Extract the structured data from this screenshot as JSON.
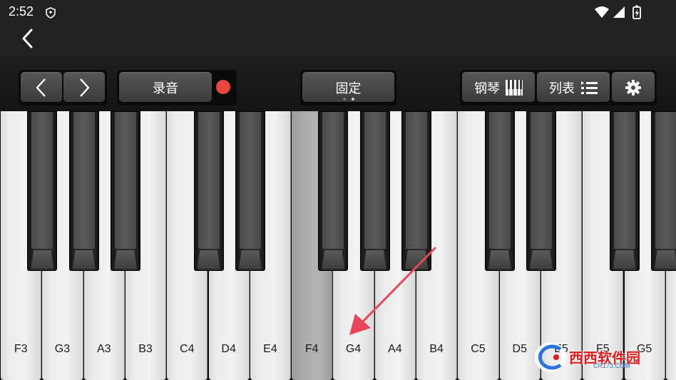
{
  "status_bar": {
    "time": "2:52",
    "icons": [
      "shield-icon",
      "wifi-icon",
      "signal-icon",
      "battery-charging-icon"
    ]
  },
  "app_bar": {
    "back_icon": "chevron-left-icon"
  },
  "toolbar": {
    "prev_icon": "chevron-left-icon",
    "next_icon": "chevron-right-icon",
    "record_label": "录音",
    "record_indicator_color": "#e8473d",
    "fixed_label": "固定",
    "fixed_pages": {
      "count": 2,
      "active": 2
    },
    "piano_label": "钢琴",
    "piano_icon": "piano-keys-icon",
    "list_label": "列表",
    "list_icon": "list-icon",
    "settings_icon": "gear-icon"
  },
  "keyboard": {
    "white_keys": [
      "F3",
      "G3",
      "A3",
      "B3",
      "C4",
      "D4",
      "E4",
      "F4",
      "G4",
      "A4",
      "B4",
      "C5",
      "D5",
      "E5",
      "F5",
      "G5",
      ""
    ],
    "active_key": "F4",
    "black_keys": [
      "F#3",
      "G#3",
      "A#3",
      "C#4",
      "D#4",
      "F#4",
      "G#4",
      "A#4",
      "C#5",
      "D#5",
      "F#5",
      "G#5"
    ]
  },
  "annotation": {
    "arrow_color": "#e8475a",
    "points_to": "G4"
  },
  "watermark": {
    "text": "西西软件园",
    "sub": "CR173.COM",
    "icon": "watermark-logo-icon"
  }
}
